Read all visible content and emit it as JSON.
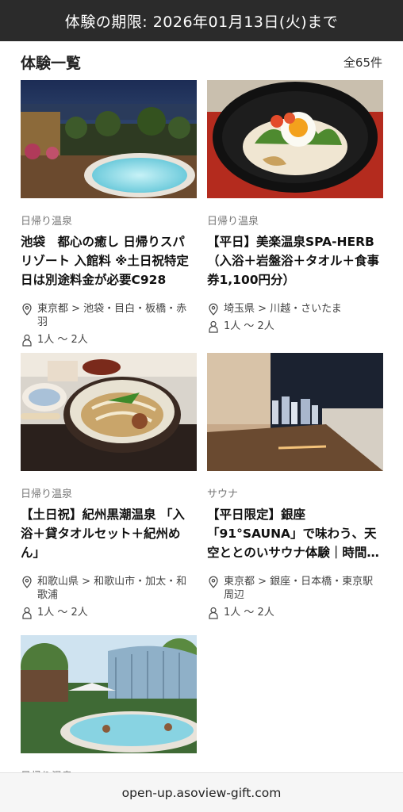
{
  "banner": {
    "text": "体験の期限: 2026年01月13日(火)まで"
  },
  "section": {
    "title": "体験一覧",
    "count": "全65件"
  },
  "cards": [
    {
      "category": "日帰り温泉",
      "title": "池袋　都心の癒し 日帰りスパリゾート 入館料 ※土日祝特定日は別途料金が必要C928",
      "location": "東京都 > 池袋・目白・板橋・赤羽",
      "people": "1人 〜 2人"
    },
    {
      "category": "日帰り温泉",
      "title": "【平日】美楽温泉SPA-HERB（入浴＋岩盤浴＋タオル＋食事券1,100円分）",
      "location": "埼玉県 > 川越・さいたま",
      "people": "1人 〜 2人"
    },
    {
      "category": "日帰り温泉",
      "title": "【土日祝】紀州黒潮温泉 「入浴＋貸タオルセット＋紀州めん」",
      "location": "和歌山県 > 和歌山市・加太・和歌浦",
      "people": "1人 〜 2人"
    },
    {
      "category": "サウナ",
      "title": "【平日限定】銀座「91°SAUNA」で味わう、天空ととのいサウナ体験｜時間…",
      "location": "東京都 > 銀座・日本橋・東京駅周辺",
      "people": "1人 〜 2人"
    },
    {
      "category": "日帰り温泉"
    }
  ],
  "footer": {
    "domain": "open-up.asoview-gift.com"
  }
}
